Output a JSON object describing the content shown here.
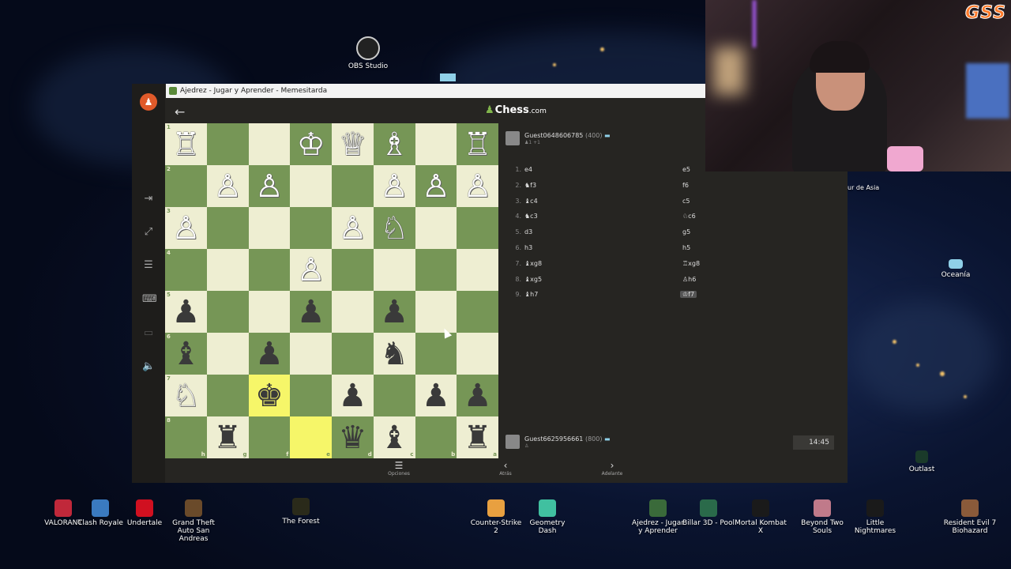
{
  "desktop": {
    "icons_top": [
      {
        "label": "OBS Studio"
      }
    ],
    "icons_right": [
      {
        "label": "Oceanía"
      },
      {
        "label": "Outlast"
      }
    ],
    "partial_label": "ur de Asia",
    "icons_bottom": [
      {
        "label": "VALORANT"
      },
      {
        "label": "Clash Royale"
      },
      {
        "label": "Undertale"
      },
      {
        "label": "Grand Theft Auto San Andreas"
      },
      {
        "label": "The Forest"
      },
      {
        "label": "Counter-Strike 2"
      },
      {
        "label": "Geometry Dash"
      },
      {
        "label": "Ajedrez - Jugar y Aprender"
      },
      {
        "label": "Billar 3D - Pool"
      },
      {
        "label": "Mortal Kombat X"
      },
      {
        "label": "Beyond Two Souls"
      },
      {
        "label": "Little Nightmares"
      },
      {
        "label": "Resident Evil 7 Biohazard"
      }
    ]
  },
  "stream": {
    "logo": "GSS"
  },
  "window": {
    "title": "Ajedrez - Jugar y Aprender - Memesitarda",
    "brand_name": "Chess",
    "brand_suffix": ".com"
  },
  "players": {
    "top": {
      "name": "Guest0648606785",
      "rating": "(400)",
      "sub": "♟1  +1"
    },
    "bottom": {
      "name": "Guest6625956661",
      "rating": "(800)",
      "sub": "♙"
    }
  },
  "clock": "14:45",
  "moves": [
    {
      "n": "1.",
      "w": "e4",
      "b": "e5"
    },
    {
      "n": "2.",
      "w": "♞f3",
      "b": "f6"
    },
    {
      "n": "3.",
      "w": "♝c4",
      "b": "c5"
    },
    {
      "n": "4.",
      "w": "♞c3",
      "b": "♘c6"
    },
    {
      "n": "5.",
      "w": "d3",
      "b": "g5"
    },
    {
      "n": "6.",
      "w": "h3",
      "b": "h5"
    },
    {
      "n": "7.",
      "w": "♝xg8",
      "b": "♖xg8"
    },
    {
      "n": "8.",
      "w": "♝xg5",
      "b": "♙h6"
    },
    {
      "n": "9.",
      "w": "♝h7",
      "b": "♔f7"
    }
  ],
  "board": {
    "ranks": [
      "1",
      "2",
      "3",
      "4",
      "5",
      "6",
      "7",
      "8"
    ],
    "files": [
      "h",
      "g",
      "f",
      "e",
      "d",
      "c",
      "b",
      "a"
    ],
    "rows": [
      [
        "wR",
        "",
        "",
        "wK",
        "wQ",
        "wB",
        "",
        "wR"
      ],
      [
        "",
        "wP",
        "wP",
        "",
        "",
        "wP",
        "wP",
        "wP"
      ],
      [
        "wP",
        "",
        "",
        "",
        "wP",
        "wN",
        "",
        ""
      ],
      [
        "",
        "",
        "",
        "wP",
        "",
        "",
        "",
        ""
      ],
      [
        "bP",
        "",
        "",
        "bP",
        "",
        "bP",
        "",
        ""
      ],
      [
        "bB",
        "",
        "bP",
        "",
        "",
        "bN",
        "",
        ""
      ],
      [
        "wN",
        "",
        "bK",
        "",
        "bP",
        "",
        "bP",
        "bP"
      ],
      [
        "",
        "bR",
        "",
        "",
        "bQ",
        "bB",
        "",
        "bR"
      ]
    ]
  },
  "bottom_nav": [
    {
      "icon": "☰",
      "label": "Opciones"
    },
    {
      "icon": "‹",
      "label": "Atrás"
    },
    {
      "icon": "›",
      "label": "Adelante"
    }
  ]
}
